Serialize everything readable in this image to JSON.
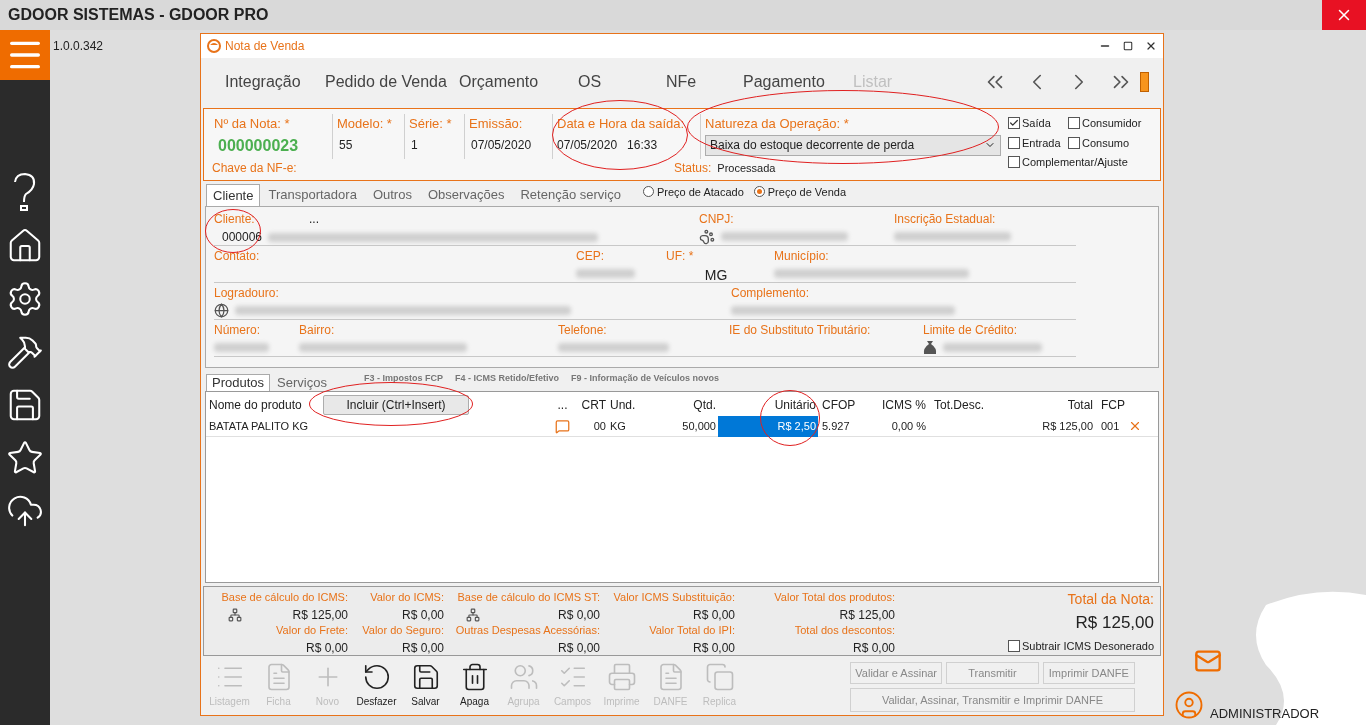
{
  "app": {
    "title": "GDOOR SISTEMAS - GDOOR PRO",
    "version": "1.0.0.342",
    "user": "ADMINISTRADOR"
  },
  "window": {
    "title": "Nota de Venda"
  },
  "nav_tabs": [
    {
      "label": "Integração",
      "disabled": false
    },
    {
      "label": "Pedido de Venda",
      "disabled": false
    },
    {
      "label": "Orçamento",
      "disabled": false
    },
    {
      "label": "OS",
      "disabled": false
    },
    {
      "label": "NFe",
      "disabled": false
    },
    {
      "label": "Pagamento",
      "disabled": false
    },
    {
      "label": "Listar",
      "disabled": true
    }
  ],
  "header": {
    "fields": [
      {
        "label": "Nº da Nota: *",
        "value": "000000023",
        "kind": "number"
      },
      {
        "label": "Modelo: *",
        "value": "55",
        "kind": "text"
      },
      {
        "label": "Série: *",
        "value": "1",
        "kind": "text"
      },
      {
        "label": "Emissão:",
        "value": "07/05/2020",
        "kind": "text"
      },
      {
        "label": "Data e Hora da saída:",
        "value": "07/05/2020",
        "time": "16:33",
        "kind": "datetime"
      },
      {
        "label": "Natureza da Operação: *",
        "value": "Baixa do estoque decorrente de perda",
        "kind": "select"
      }
    ],
    "chave": {
      "label": "Chave da NF-e:"
    },
    "status": {
      "label": "Status:",
      "value": "Processada"
    },
    "options": [
      {
        "label": "Saída",
        "checked": true
      },
      {
        "label": "Consumidor",
        "checked": false
      },
      {
        "label": "Entrada",
        "checked": false
      },
      {
        "label": "Consumo",
        "checked": false
      },
      {
        "label": "Complementar/Ajuste",
        "checked": false
      }
    ]
  },
  "client_tabs": [
    {
      "label": "Cliente",
      "selected": true
    },
    {
      "label": "Transportadora",
      "selected": false
    },
    {
      "label": "Outros",
      "selected": false
    },
    {
      "label": "Observações",
      "selected": false
    },
    {
      "label": "Retenção serviço",
      "selected": false
    }
  ],
  "price_options": [
    {
      "label": "Preço de Atacado",
      "selected": false
    },
    {
      "label": "Preço de Venda",
      "selected": true
    }
  ],
  "client_rows": [
    {
      "fields": [
        {
          "label": "Cliente:",
          "lookup": "...",
          "value": "000006",
          "redacted": true,
          "kind": "text"
        },
        {
          "label": "CNPJ:",
          "redacted": true,
          "kind": "document"
        },
        {
          "label": "Inscrição Estadual:",
          "redacted": true,
          "kind": "text"
        }
      ]
    },
    {
      "fields": [
        {
          "label": "Contato:",
          "redacted": false,
          "kind": "text"
        },
        {
          "label": "CEP:",
          "redacted": true,
          "kind": "text"
        },
        {
          "label": "UF: *",
          "value": "MG",
          "redacted": false,
          "kind": "text"
        },
        {
          "label": "Município:",
          "redacted": true,
          "kind": "text"
        }
      ]
    },
    {
      "fields": [
        {
          "label": "Logradouro:",
          "redacted": true,
          "kind": "address"
        },
        {
          "label": "Complemento:",
          "redacted": true,
          "kind": "text"
        }
      ]
    },
    {
      "fields": [
        {
          "label": "Número:",
          "redacted": true,
          "kind": "text"
        },
        {
          "label": "Bairro:",
          "redacted": true,
          "kind": "text"
        },
        {
          "label": "Telefone:",
          "redacted": true,
          "kind": "text"
        },
        {
          "label": "IE do Substituto Tributário:",
          "redacted": false,
          "kind": "text"
        },
        {
          "label": "Limite de Crédito:",
          "redacted": true,
          "kind": "credit"
        }
      ]
    }
  ],
  "product_tabs": [
    {
      "label": "Produtos",
      "selected": true
    },
    {
      "label": "Serviços",
      "selected": false
    }
  ],
  "shortcuts": [
    "F3 - Impostos FCP",
    "F4 - ICMS Retido/Efetivo",
    "F9 - Informação de Veículos novos"
  ],
  "products": {
    "include_button": "Incluir (Ctrl+Insert)",
    "columns": [
      "Nome do produto",
      "...",
      "CRT",
      "Und.",
      "Qtd.",
      "Unitário",
      "CFOP",
      "ICMS %",
      "Tot.Desc.",
      "Total",
      "FCP"
    ],
    "rows": [
      {
        "name": "BATATA PALITO KG",
        "crt": "00",
        "unit": "KG",
        "qty": "50,000",
        "price": "R$ 2,50",
        "price_selected": true,
        "cfop": "5.927",
        "icms": "0,00 %",
        "total": "R$ 125,00",
        "fcp": "001"
      }
    ]
  },
  "totals": [
    {
      "label": "Base de cálculo do ICMS:",
      "value": "R$ 125,00",
      "kind": "tree"
    },
    {
      "label": "Valor do ICMS:",
      "value": "R$ 0,00",
      "kind": "plain"
    },
    {
      "label": "Base de cálculo do ICMS ST:",
      "value": "R$ 0,00",
      "kind": "tree"
    },
    {
      "label": "Valor ICMS Substituição:",
      "value": "R$ 0,00",
      "kind": "plain"
    },
    {
      "label": "Valor Total dos produtos:",
      "value": "R$ 125,00",
      "kind": "plain"
    },
    {
      "label": "Valor do Frete:",
      "value": "R$ 0,00",
      "kind": "plain"
    },
    {
      "label": "Valor do Seguro:",
      "value": "R$ 0,00",
      "kind": "plain"
    },
    {
      "label": "Outras Despesas Acessórias:",
      "value": "R$ 0,00",
      "kind": "plain"
    },
    {
      "label": "Valor Total do IPI:",
      "value": "R$ 0,00",
      "kind": "plain"
    },
    {
      "label": "Total dos descontos:",
      "value": "R$ 0,00",
      "kind": "plain"
    }
  ],
  "total_nota": {
    "label": "Total da Nota:",
    "value": "R$ 125,00"
  },
  "subtract_icms": {
    "label": "Subtrair ICMS Desonerado",
    "checked": false
  },
  "toolbar": [
    {
      "label": "Listagem",
      "kind": "list",
      "disabled": true
    },
    {
      "label": "Ficha",
      "kind": "sheet",
      "disabled": true
    },
    {
      "label": "Novo",
      "kind": "new",
      "disabled": true
    },
    {
      "label": "Desfazer",
      "kind": "undo",
      "disabled": false
    },
    {
      "label": "Salvar",
      "kind": "save",
      "disabled": false
    },
    {
      "label": "Apaga",
      "kind": "delete",
      "disabled": false
    },
    {
      "label": "Agrupa",
      "kind": "group",
      "disabled": true
    },
    {
      "label": "Campos",
      "kind": "fields",
      "disabled": true
    },
    {
      "label": "Imprime",
      "kind": "print",
      "disabled": true
    },
    {
      "label": "DANFE",
      "kind": "sheet",
      "disabled": true
    },
    {
      "label": "Replica",
      "kind": "copy",
      "disabled": true
    }
  ],
  "actions": [
    {
      "label": "Validar e Assinar",
      "disabled": true
    },
    {
      "label": "Transmitir",
      "disabled": true
    },
    {
      "label": "Imprimir DANFE",
      "disabled": true
    },
    {
      "label": "Validar, Assinar, Transmitir e Imprimir DANFE",
      "disabled": true
    }
  ]
}
